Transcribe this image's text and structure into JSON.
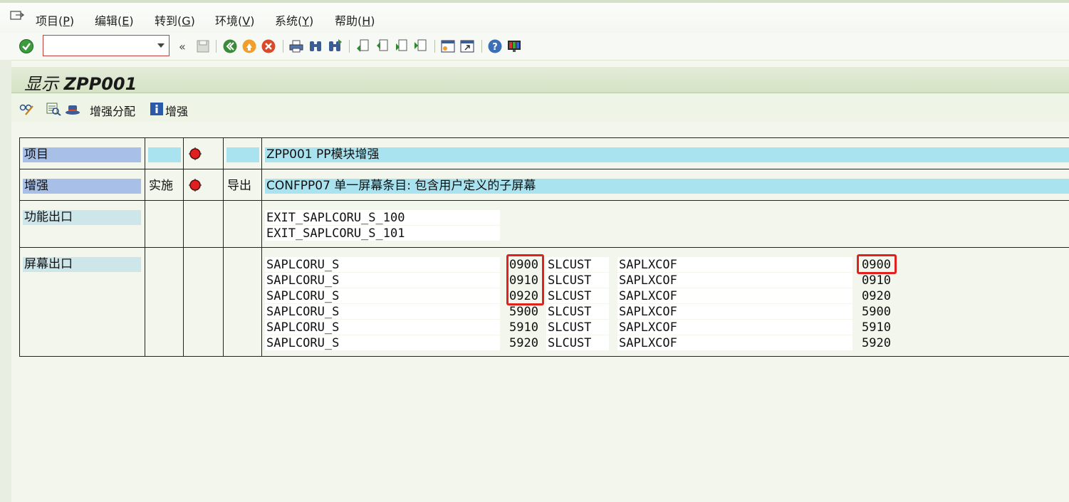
{
  "menu": [
    {
      "label": "项目(",
      "key": "P",
      "end": ")"
    },
    {
      "label": "编辑(",
      "key": "E",
      "end": ")"
    },
    {
      "label": "转到(",
      "key": "G",
      "end": ")"
    },
    {
      "label": "环境(",
      "key": "V",
      "end": ")"
    },
    {
      "label": "系统(",
      "key": "Y",
      "end": ")"
    },
    {
      "label": "帮助(",
      "key": "H",
      "end": ")"
    }
  ],
  "toolbar": {
    "command_value": "",
    "collapse_label": "«"
  },
  "title": {
    "prefix": "显示 ",
    "name": "ZPP001"
  },
  "app_toolbar": {
    "assign_label": "增强分配",
    "enh_label": "增强"
  },
  "table": {
    "row1": {
      "label": "项目",
      "value": "ZPP001    PP模块增强"
    },
    "row2": {
      "label": "增强",
      "impl": "实施",
      "export": "导出",
      "value": "CONFPP07 单一屏幕条目: 包含用户定义的子屏幕"
    },
    "row3": {
      "label": "功能出口",
      "exits": [
        "EXIT_SAPLCORU_S_100",
        "EXIT_SAPLCORU_S_101"
      ]
    },
    "row4": {
      "label": "屏幕出口",
      "rows": [
        {
          "prog": "SAPLCORU_S",
          "num": "0900",
          "area": "SLCUST",
          "prog2": "SAPLXCOF",
          "num2": "0900"
        },
        {
          "prog": "SAPLCORU_S",
          "num": "0910",
          "area": "SLCUST",
          "prog2": "SAPLXCOF",
          "num2": "0910"
        },
        {
          "prog": "SAPLCORU_S",
          "num": "0920",
          "area": "SLCUST",
          "prog2": "SAPLXCOF",
          "num2": "0920"
        },
        {
          "prog": "SAPLCORU_S",
          "num": "5900",
          "area": "SLCUST",
          "prog2": "SAPLXCOF",
          "num2": "5900"
        },
        {
          "prog": "SAPLCORU_S",
          "num": "5910",
          "area": "SLCUST",
          "prog2": "SAPLXCOF",
          "num2": "5910"
        },
        {
          "prog": "SAPLCORU_S",
          "num": "5920",
          "area": "SLCUST",
          "prog2": "SAPLXCOF",
          "num2": "5920"
        }
      ]
    }
  },
  "colors": {
    "highlight_box": "#e0221f",
    "label_blue": "#a8c0e8",
    "value_cyan": "#a9e3ef",
    "status_red": "#e02020"
  }
}
